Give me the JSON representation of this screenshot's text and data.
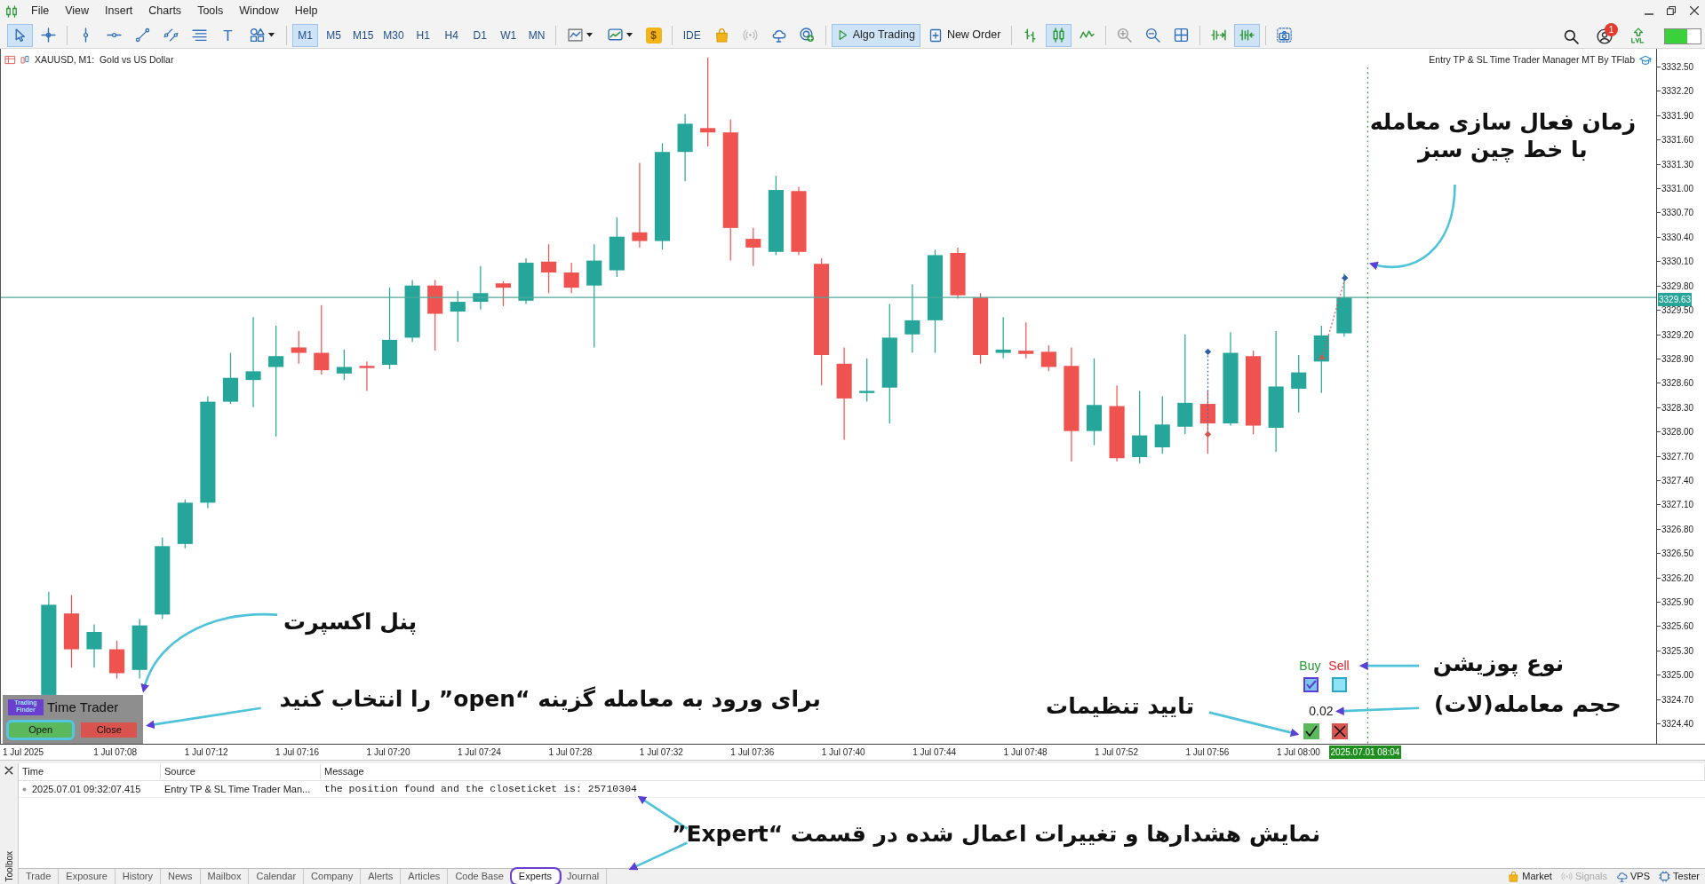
{
  "menu_bar": {
    "items": [
      "File",
      "View",
      "Insert",
      "Charts",
      "Tools",
      "Window",
      "Help"
    ]
  },
  "toolbar": {
    "items": [
      {
        "kind": "cursor",
        "selected": true
      },
      {
        "kind": "crosshair",
        "selected": false
      },
      {
        "kind": "separator"
      },
      {
        "kind": "vline",
        "selected": false
      },
      {
        "kind": "hline",
        "selected": false
      },
      {
        "kind": "trendline",
        "selected": false
      },
      {
        "kind": "channel",
        "selected": false
      },
      {
        "kind": "fibo",
        "selected": false
      },
      {
        "kind": "text_tool",
        "label": "T",
        "selected": false
      },
      {
        "kind": "shapes",
        "selected": false
      },
      {
        "kind": "separator"
      },
      {
        "kind": "timeframe",
        "label": "M1",
        "selected": true
      },
      {
        "kind": "timeframe",
        "label": "M5",
        "selected": false
      },
      {
        "kind": "timeframe",
        "label": "M15",
        "selected": false
      },
      {
        "kind": "timeframe",
        "label": "M30",
        "selected": false
      },
      {
        "kind": "timeframe",
        "label": "H1",
        "selected": false
      },
      {
        "kind": "timeframe",
        "label": "H4",
        "selected": false
      },
      {
        "kind": "timeframe",
        "label": "D1",
        "selected": false
      },
      {
        "kind": "timeframe",
        "label": "W1",
        "selected": false
      },
      {
        "kind": "timeframe",
        "label": "MN",
        "selected": false
      },
      {
        "kind": "separator"
      },
      {
        "kind": "indicators",
        "selected": false
      },
      {
        "kind": "templates",
        "selected": false
      },
      {
        "kind": "dollar",
        "label": "$",
        "selected": false
      },
      {
        "kind": "separator"
      },
      {
        "kind": "text_button",
        "label": "IDE",
        "selected": false
      },
      {
        "kind": "bag",
        "selected": false
      },
      {
        "kind": "signal",
        "selected": false
      },
      {
        "kind": "cloud",
        "selected": false
      },
      {
        "kind": "radar",
        "selected": false
      },
      {
        "kind": "separator"
      },
      {
        "kind": "algo",
        "label": "Algo Trading",
        "selected": true
      },
      {
        "kind": "new_order",
        "label": "New Order",
        "selected": false
      },
      {
        "kind": "separator"
      },
      {
        "kind": "bars",
        "selected": false
      },
      {
        "kind": "candles",
        "selected": true
      },
      {
        "kind": "line",
        "selected": false
      },
      {
        "kind": "separator"
      },
      {
        "kind": "zoom_in",
        "selected": false
      },
      {
        "kind": "zoom_out",
        "selected": false
      },
      {
        "kind": "grid",
        "selected": false
      },
      {
        "kind": "separator"
      },
      {
        "kind": "autoscroll",
        "selected": false
      },
      {
        "kind": "shift",
        "selected": true
      },
      {
        "kind": "separator"
      },
      {
        "kind": "screenshot",
        "selected": false
      }
    ],
    "notifications": "1"
  },
  "chart": {
    "symbol_title": "XAUUSD, M1:  Gold vs US Dollar",
    "expert_name": "Entry TP & SL Time Trader Manager MT By TFlab",
    "price_labels": [
      "3332.50",
      "3332.20",
      "3331.90",
      "3331.60",
      "3331.30",
      "3331.00",
      "3330.70",
      "3330.40",
      "3330.10",
      "3329.80",
      "3329.50",
      "3329.20",
      "3328.90",
      "3328.60",
      "3328.30",
      "3328.00",
      "3327.70",
      "3327.40",
      "3327.10",
      "3326.80",
      "3326.50",
      "3326.20",
      "3325.90",
      "3325.60",
      "3325.30",
      "3325.00",
      "3324.70",
      "3324.40"
    ],
    "current_price": "3329.63",
    "time_labels": [
      "1 Jul 2025",
      "1 Jul 07:08",
      "1 Jul 07:12",
      "1 Jul 07:16",
      "1 Jul 07:20",
      "1 Jul 07:24",
      "1 Jul 07:28",
      "1 Jul 07:32",
      "1 Jul 07:36",
      "1 Jul 07:40",
      "1 Jul 07:44",
      "1 Jul 07:48",
      "1 Jul 07:52",
      "1 Jul 07:56",
      "1 Jul 08:00"
    ],
    "current_time": "2025.07.01 08:04",
    "expert_panel": {
      "logo_text": "Trading Finder",
      "title": "Time Trader",
      "buttons": [
        {
          "kind": "open",
          "label": "Open",
          "highlighted": true
        },
        {
          "kind": "close",
          "label": "Close",
          "highlighted": false
        }
      ]
    },
    "position_panel": {
      "options": [
        {
          "kind": "buy",
          "label": "Buy",
          "checked": true
        },
        {
          "kind": "sell",
          "label": "Sell",
          "checked": false
        }
      ],
      "lot": "0.02",
      "actions": [
        {
          "kind": "confirm"
        },
        {
          "kind": "cancel"
        }
      ]
    }
  },
  "annotations": [
    {
      "text": "زمان فعال سازی معامله\nبا خط چین سبز"
    },
    {
      "text": "پنل اکسپرت"
    },
    {
      "text": "برای ورود به معامله گزینه “open” را انتخاب کنید"
    },
    {
      "text": "نوع پوزیشن"
    },
    {
      "text": "حجم معامله(لات)"
    },
    {
      "text": "تایید تنظیمات"
    },
    {
      "text": "نمایش هشدارها و تغییرات اعمال شده در قسمت “Expert”"
    }
  ],
  "toolbox": {
    "side_label": "Toolbox",
    "columns": [
      "Time",
      "Source",
      "Message"
    ],
    "rows": [
      {
        "time": "2025.07.01 09:32:07.415",
        "source": "Entry TP & SL Time Trader Man...",
        "message": "the position found and the closeticket is: 25710304"
      }
    ],
    "tabs": [
      {
        "label": "Trade",
        "selected": false,
        "highlighted": false
      },
      {
        "label": "Exposure",
        "selected": false,
        "highlighted": false
      },
      {
        "label": "History",
        "selected": false,
        "highlighted": false
      },
      {
        "label": "News",
        "selected": false,
        "highlighted": false
      },
      {
        "label": "Mailbox",
        "selected": false,
        "highlighted": false
      },
      {
        "label": "Calendar",
        "selected": false,
        "highlighted": false
      },
      {
        "label": "Company",
        "selected": false,
        "highlighted": false
      },
      {
        "label": "Alerts",
        "selected": false,
        "highlighted": false
      },
      {
        "label": "Articles",
        "selected": false,
        "highlighted": false
      },
      {
        "label": "Code Base",
        "selected": false,
        "highlighted": false
      },
      {
        "label": "Experts",
        "selected": true,
        "highlighted": true
      },
      {
        "label": "Journal",
        "selected": false,
        "highlighted": false
      }
    ],
    "status_items": [
      {
        "kind": "market",
        "label": "Market",
        "disabled": false
      },
      {
        "kind": "signals",
        "label": "Signals",
        "disabled": true
      },
      {
        "kind": "vps",
        "label": "VPS",
        "disabled": false
      },
      {
        "kind": "tester",
        "label": "Tester",
        "disabled": false
      }
    ]
  }
}
